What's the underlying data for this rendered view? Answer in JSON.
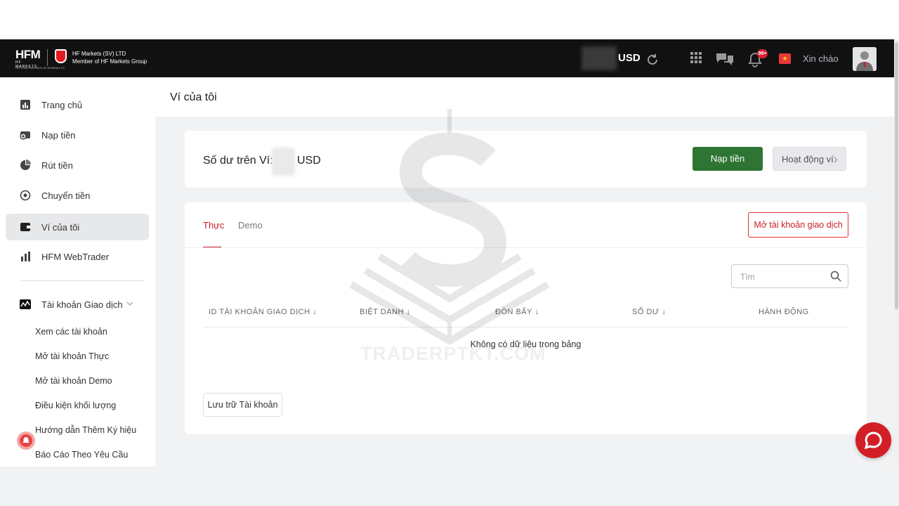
{
  "brand": {
    "logo_text": "HFM",
    "logo_sub": "HF MARKETS",
    "partner_text": "OFFICIAL PARTNER OF ARSENAL FC",
    "company_line1": "HF Markets (SV) LTD",
    "company_line2": "Member of HF Markets Group"
  },
  "topbar": {
    "balance_currency": "USD",
    "notification_count": "99+",
    "flag_glyph": "★",
    "greeting": "Xin chào",
    "icons": [
      "refresh-icon",
      "apps-grid-icon",
      "chat-icon",
      "bell-icon",
      "flag-icon",
      "avatar"
    ]
  },
  "sidebar": {
    "items": [
      {
        "label": "Trang chủ",
        "icon": "dashboard-icon"
      },
      {
        "label": "Nạp tiền",
        "icon": "deposit-icon"
      },
      {
        "label": "Rút tiền",
        "icon": "withdraw-icon"
      },
      {
        "label": "Chuyển tiền",
        "icon": "transfer-icon"
      },
      {
        "label": "Ví của tôi",
        "icon": "wallet-icon",
        "active": true
      },
      {
        "label": "HFM WebTrader",
        "icon": "bar-chart-icon"
      }
    ],
    "section": {
      "label": "Tài khoản Giao dịch",
      "icon": "trading-account-icon"
    },
    "sub_items": [
      "Xem các tài khoản",
      "Mở tài khoản Thực",
      "Mở tài khoản Demo",
      "Điều kiện khối lượng",
      "Hướng dẫn Thêm Ký hiệu",
      "Báo Cáo Theo Yêu Cầu"
    ]
  },
  "page": {
    "title": "Ví của tôi",
    "watermark": "TRADERPTKT.COM"
  },
  "wallet": {
    "balance_label": "Số dư trên Ví:",
    "balance_currency": "USD",
    "deposit_button": "Nạp tiền",
    "activity_button": "Hoạt động ví"
  },
  "accounts": {
    "tabs": [
      "Thực",
      "Demo"
    ],
    "active_tab": "Thực",
    "open_account_button": "Mở tài khoản giao dịch",
    "search_placeholder": "Tìm",
    "columns": [
      "ID TÀI KHOẢN GIAO DỊCH",
      "BIỆT DANH",
      "ĐÒN BẨY",
      "SỐ DƯ",
      "HÀNH ĐỘNG"
    ],
    "empty_message": "Không có dữ liệu trong bảng",
    "archive_button": "Lưu trữ Tài khoản"
  },
  "colors": {
    "nav_bg": "#111111",
    "accent_red": "#c82027",
    "deposit_green": "#2e7533"
  }
}
